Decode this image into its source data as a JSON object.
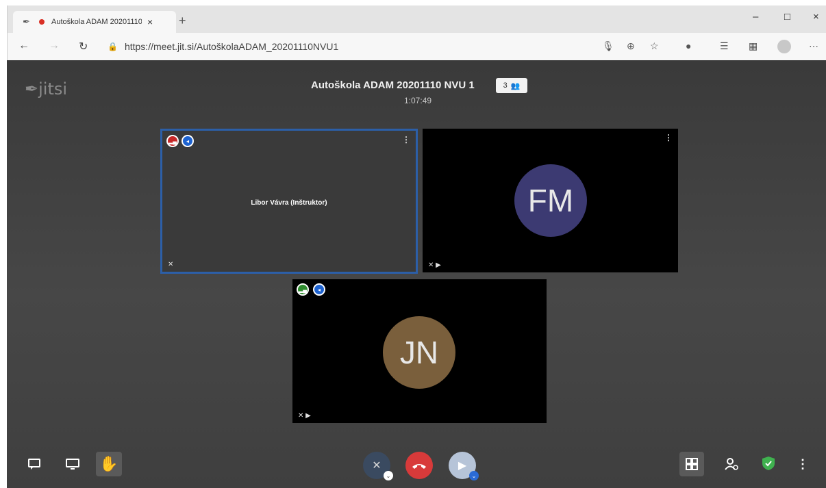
{
  "browser": {
    "tab_title": "Autoškola ADAM 20201110",
    "tab_close": "×",
    "new_tab": "+",
    "minimize": "–",
    "maximize": "□",
    "close": "×",
    "url_host": "https://meet.jit.si",
    "url_path": "/AutoškolaADAM_20201110NVU1"
  },
  "meeting": {
    "logo_text": "jitsi",
    "title": "Autoškola ADAM 20201110 NVU 1",
    "participant_count": "3",
    "elapsed": "1:07:49"
  },
  "participants": [
    {
      "display_name": "Libor Vávra (Inštruktor)",
      "initials": "",
      "avatar_color": "",
      "connection": "poor",
      "active_speaker": true
    },
    {
      "display_name": "",
      "initials": "FM",
      "avatar_color": "#3c3a72",
      "connection": "",
      "active_speaker": false
    },
    {
      "display_name": "",
      "initials": "JN",
      "avatar_color": "#7a5f3c",
      "connection": "good",
      "active_speaker": false
    }
  ],
  "colors": {
    "accent_active_border": "#2c5fa8",
    "hangup": "#d83a3a",
    "background": "#3f3f3f"
  }
}
